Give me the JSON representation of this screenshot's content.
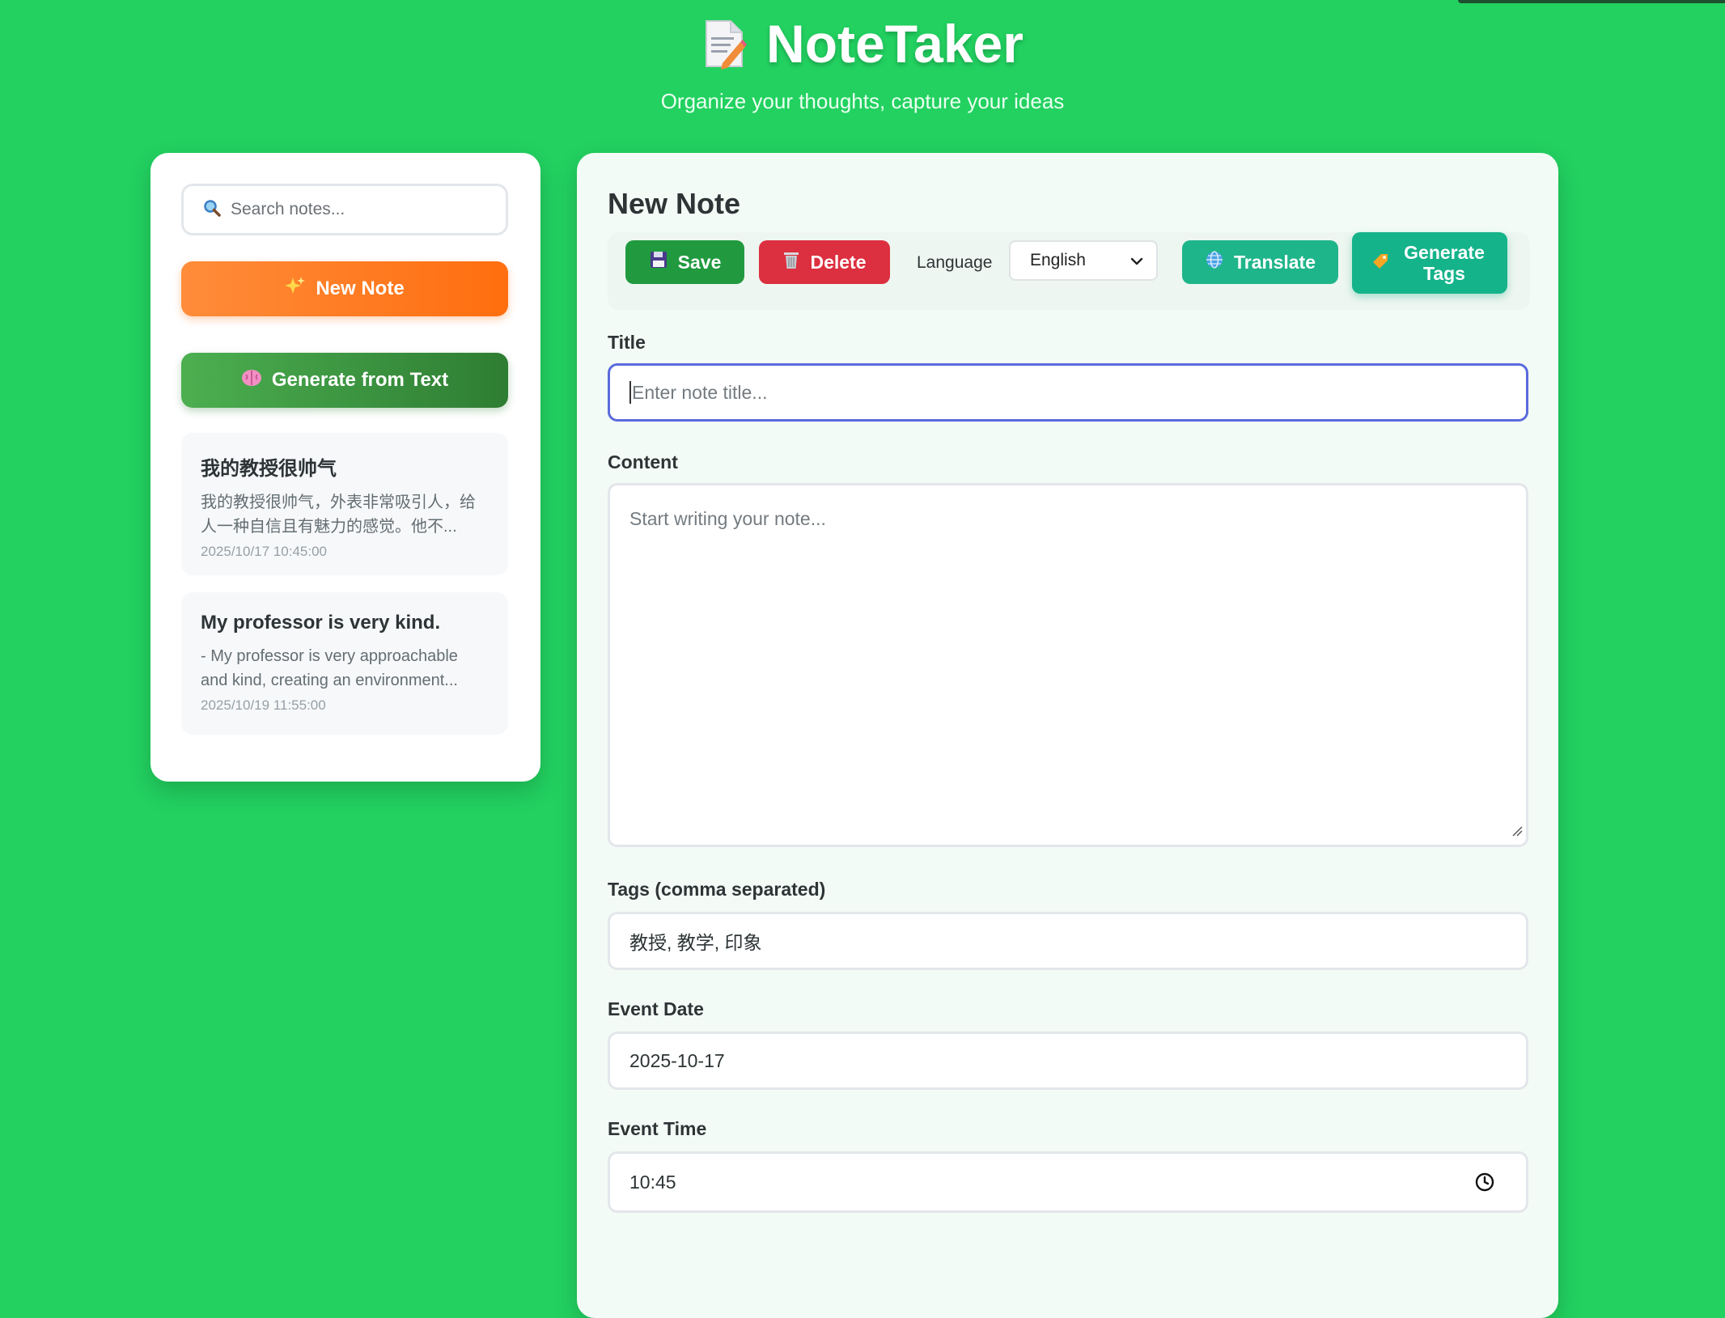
{
  "header": {
    "title": "NoteTaker",
    "subtitle": "Organize your thoughts, capture your ideas",
    "logo_icon": "memo-icon"
  },
  "sidebar": {
    "search": {
      "placeholder": "Search notes...",
      "icon": "search-icon"
    },
    "new_note_label": "New Note",
    "generate_from_text_label": "Generate from Text",
    "notes": [
      {
        "title": "我的教授很帅气",
        "preview": "我的教授很帅气，外表非常吸引人，给人一种自信且有魅力的感觉。他不...",
        "date": "2025/10/17 10:45:00"
      },
      {
        "title": "My professor is very kind.",
        "preview": "- My professor is very approachable and kind, creating an environment...",
        "date": "2025/10/19 11:55:00"
      }
    ]
  },
  "editor": {
    "heading": "New Note",
    "toolbar": {
      "save_label": "Save",
      "delete_label": "Delete",
      "language_label": "Language",
      "language_selected": "English",
      "translate_label": "Translate",
      "generate_tags_label": "Generate Tags"
    },
    "fields": {
      "title_label": "Title",
      "title_placeholder": "Enter note title...",
      "content_label": "Content",
      "content_placeholder": "Start writing your note...",
      "tags_label": "Tags (comma separated)",
      "tags_value": "教授, 教学, 印象",
      "event_date_label": "Event Date",
      "event_date_value": "2025-10-17",
      "event_time_label": "Event Time",
      "event_time_value": "10:45"
    }
  },
  "colors": {
    "background": "#22d160",
    "new_note": "#ff7a1f",
    "generate_from_text": "#3a9a3f",
    "save": "#219a3f",
    "delete": "#dc2f3f",
    "translate": "#1fb58a",
    "focus_border": "#5a6bdc"
  }
}
